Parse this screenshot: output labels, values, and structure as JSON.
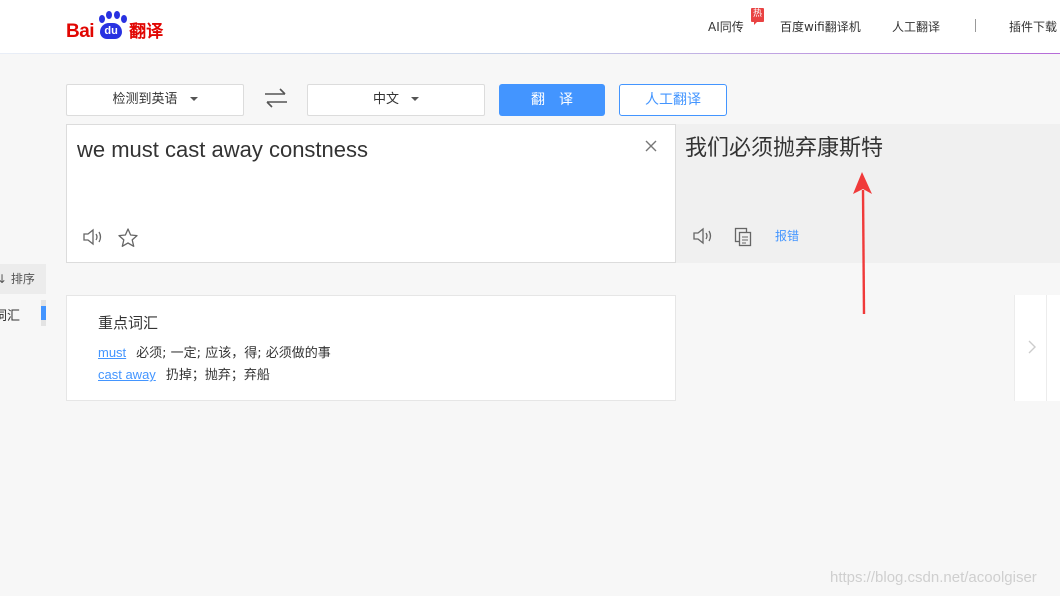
{
  "header": {
    "logo": {
      "bai": "Bai",
      "du": "du",
      "name": "翻译"
    },
    "nav": {
      "ai_simul": "AI同传",
      "hot_badge": "热",
      "wifi_translator": "百度wifi翻译机",
      "human_translate": "人工翻译",
      "plugin_download": "插件下载"
    }
  },
  "controls": {
    "source_lang": "检测到英语",
    "target_lang": "中文",
    "translate_button": "翻译",
    "human_button": "人工翻译"
  },
  "input": {
    "text": "we must cast away constness"
  },
  "output": {
    "text": "我们必须抛弃康斯特",
    "report_label": "报错"
  },
  "sidebar": {
    "sort_label": "↓ 排序",
    "vocab_label": "词汇"
  },
  "vocabulary": {
    "title": "重点词汇",
    "items": [
      {
        "word": "must",
        "definition": "必须; 一定; 应该，得; 必须做的事"
      },
      {
        "word": "cast away",
        "definition": "扔掉；抛弃；弃船"
      }
    ]
  },
  "annotation": {
    "arrow_color": "#f03a3a"
  },
  "colors": {
    "accent": "#4395ff",
    "brand_red": "#e10602",
    "brand_blue": "#2932e1"
  },
  "watermark": "https://blog.csdn.net/acoolgiser"
}
